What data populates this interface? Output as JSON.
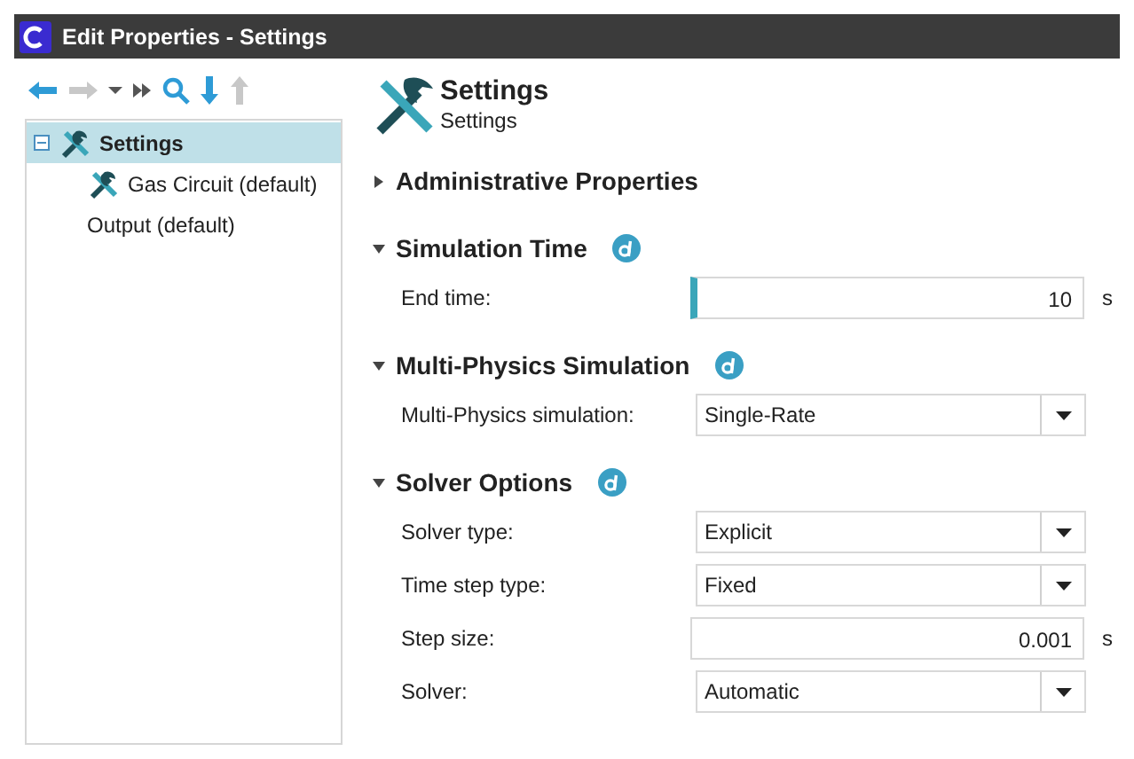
{
  "window": {
    "title": "Edit Properties - Settings"
  },
  "toolbar": [
    {
      "kind": "back",
      "disabled": false
    },
    {
      "kind": "forward",
      "disabled": true
    },
    {
      "kind": "caret",
      "disabled": false
    },
    {
      "kind": "skip",
      "disabled": false
    },
    {
      "kind": "search",
      "disabled": false
    },
    {
      "kind": "down",
      "disabled": false
    },
    {
      "kind": "up",
      "disabled": true
    }
  ],
  "tree": [
    {
      "label": "Settings",
      "kind": "settings",
      "selected": true,
      "expanded": true,
      "children": [
        {
          "label": "Gas Circuit (default)",
          "kind": "tool",
          "selected": false
        },
        {
          "label": "Output (default)",
          "kind": "plain",
          "selected": false
        }
      ]
    }
  ],
  "header": {
    "title": "Settings",
    "subtitle": "Settings"
  },
  "sections": [
    {
      "title": "Administrative Properties",
      "expanded": false
    },
    {
      "title": "Simulation Time",
      "expanded": true,
      "info": true,
      "rows": [
        {
          "label": "End time:",
          "kind": "number",
          "value": "10",
          "unit": "s",
          "focused": true
        }
      ]
    },
    {
      "title": "Multi-Physics Simulation",
      "expanded": true,
      "info": true,
      "rows": [
        {
          "label": "Multi-Physics simulation:",
          "kind": "dropdown",
          "value": "Single-Rate"
        }
      ]
    },
    {
      "title": "Solver Options",
      "expanded": true,
      "info": true,
      "rows": [
        {
          "label": "Solver type:",
          "kind": "dropdown",
          "value": "Explicit"
        },
        {
          "label": "Time step type:",
          "kind": "dropdown",
          "value": "Fixed"
        },
        {
          "label": "Step size:",
          "kind": "number",
          "value": "0.001",
          "unit": "s",
          "focused": false
        },
        {
          "label": "Solver:",
          "kind": "dropdown",
          "value": "Automatic"
        }
      ]
    }
  ]
}
